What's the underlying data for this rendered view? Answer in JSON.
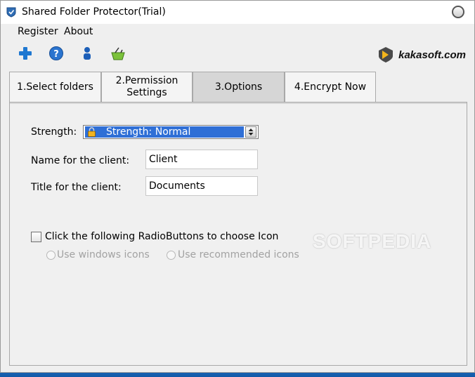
{
  "window": {
    "title": "Shared Folder Protector(Trial)"
  },
  "menu": {
    "items": [
      "Register",
      "About"
    ]
  },
  "toolbar": {
    "icons": [
      "plus-icon",
      "help-icon",
      "user-icon",
      "basket-icon"
    ],
    "brand_name": "kakasoft.com"
  },
  "tabs": [
    {
      "label": "1.Select folders"
    },
    {
      "label_line1": "2.Permission",
      "label_line2": "Settings"
    },
    {
      "label": "3.Options",
      "active": true
    },
    {
      "label": "4.Encrypt Now"
    }
  ],
  "options": {
    "strength_label": "Strength:",
    "strength_value": "Strength: Normal",
    "client_name_label": "Name for the client:",
    "client_name_value": "Client",
    "client_title_label": "Title for the client:",
    "client_title_value": "Documents",
    "icon_checkbox_label": "Click the following RadioButtons to choose Icon",
    "icon_checkbox_checked": false,
    "radio_windows_label": "Use windows icons",
    "radio_recommended_label": "Use recommended icons"
  },
  "watermark": "SOFTPEDIA",
  "colors": {
    "selection_blue": "#2f6fd6",
    "desktop_blue": "#1f6fc2",
    "disabled_text": "#a2a2a2"
  }
}
